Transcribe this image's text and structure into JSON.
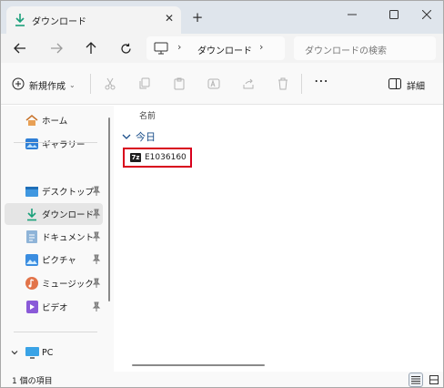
{
  "tab": {
    "title": "ダウンロード",
    "close": "✕",
    "new_tab": "+"
  },
  "address": {
    "location": "ダウンロード",
    "sep": "›",
    "search_placeholder": "ダウンロードの検索"
  },
  "commands": {
    "new_label": "新規作成",
    "new_chevron": "⌄",
    "more": "⋯",
    "details_label": "詳細"
  },
  "sidebar": {
    "items": [
      {
        "label": "ホーム",
        "icon": "home-icon"
      },
      {
        "label": "ギャラリー",
        "icon": "gallery-icon"
      },
      {
        "label": "デスクトップ",
        "icon": "desktop-icon",
        "pinned": true
      },
      {
        "label": "ダウンロード",
        "icon": "download-icon",
        "pinned": true,
        "active": true
      },
      {
        "label": "ドキュメント",
        "icon": "documents-icon",
        "pinned": true
      },
      {
        "label": "ピクチャ",
        "icon": "pictures-icon",
        "pinned": true
      },
      {
        "label": "ミュージック",
        "icon": "music-icon",
        "pinned": true
      },
      {
        "label": "ビデオ",
        "icon": "videos-icon",
        "pinned": true
      }
    ],
    "pc_label": "PC"
  },
  "content": {
    "column_header": "名前",
    "group_label": "今日",
    "files": [
      {
        "name": "E1036160",
        "icon_text": "7z",
        "highlighted": true
      }
    ]
  },
  "status": {
    "text": "1 個の項目"
  },
  "colors": {
    "accent_download": "#1aa07a",
    "highlight_border": "#d8001c",
    "group_text": "#1a4e8a"
  }
}
